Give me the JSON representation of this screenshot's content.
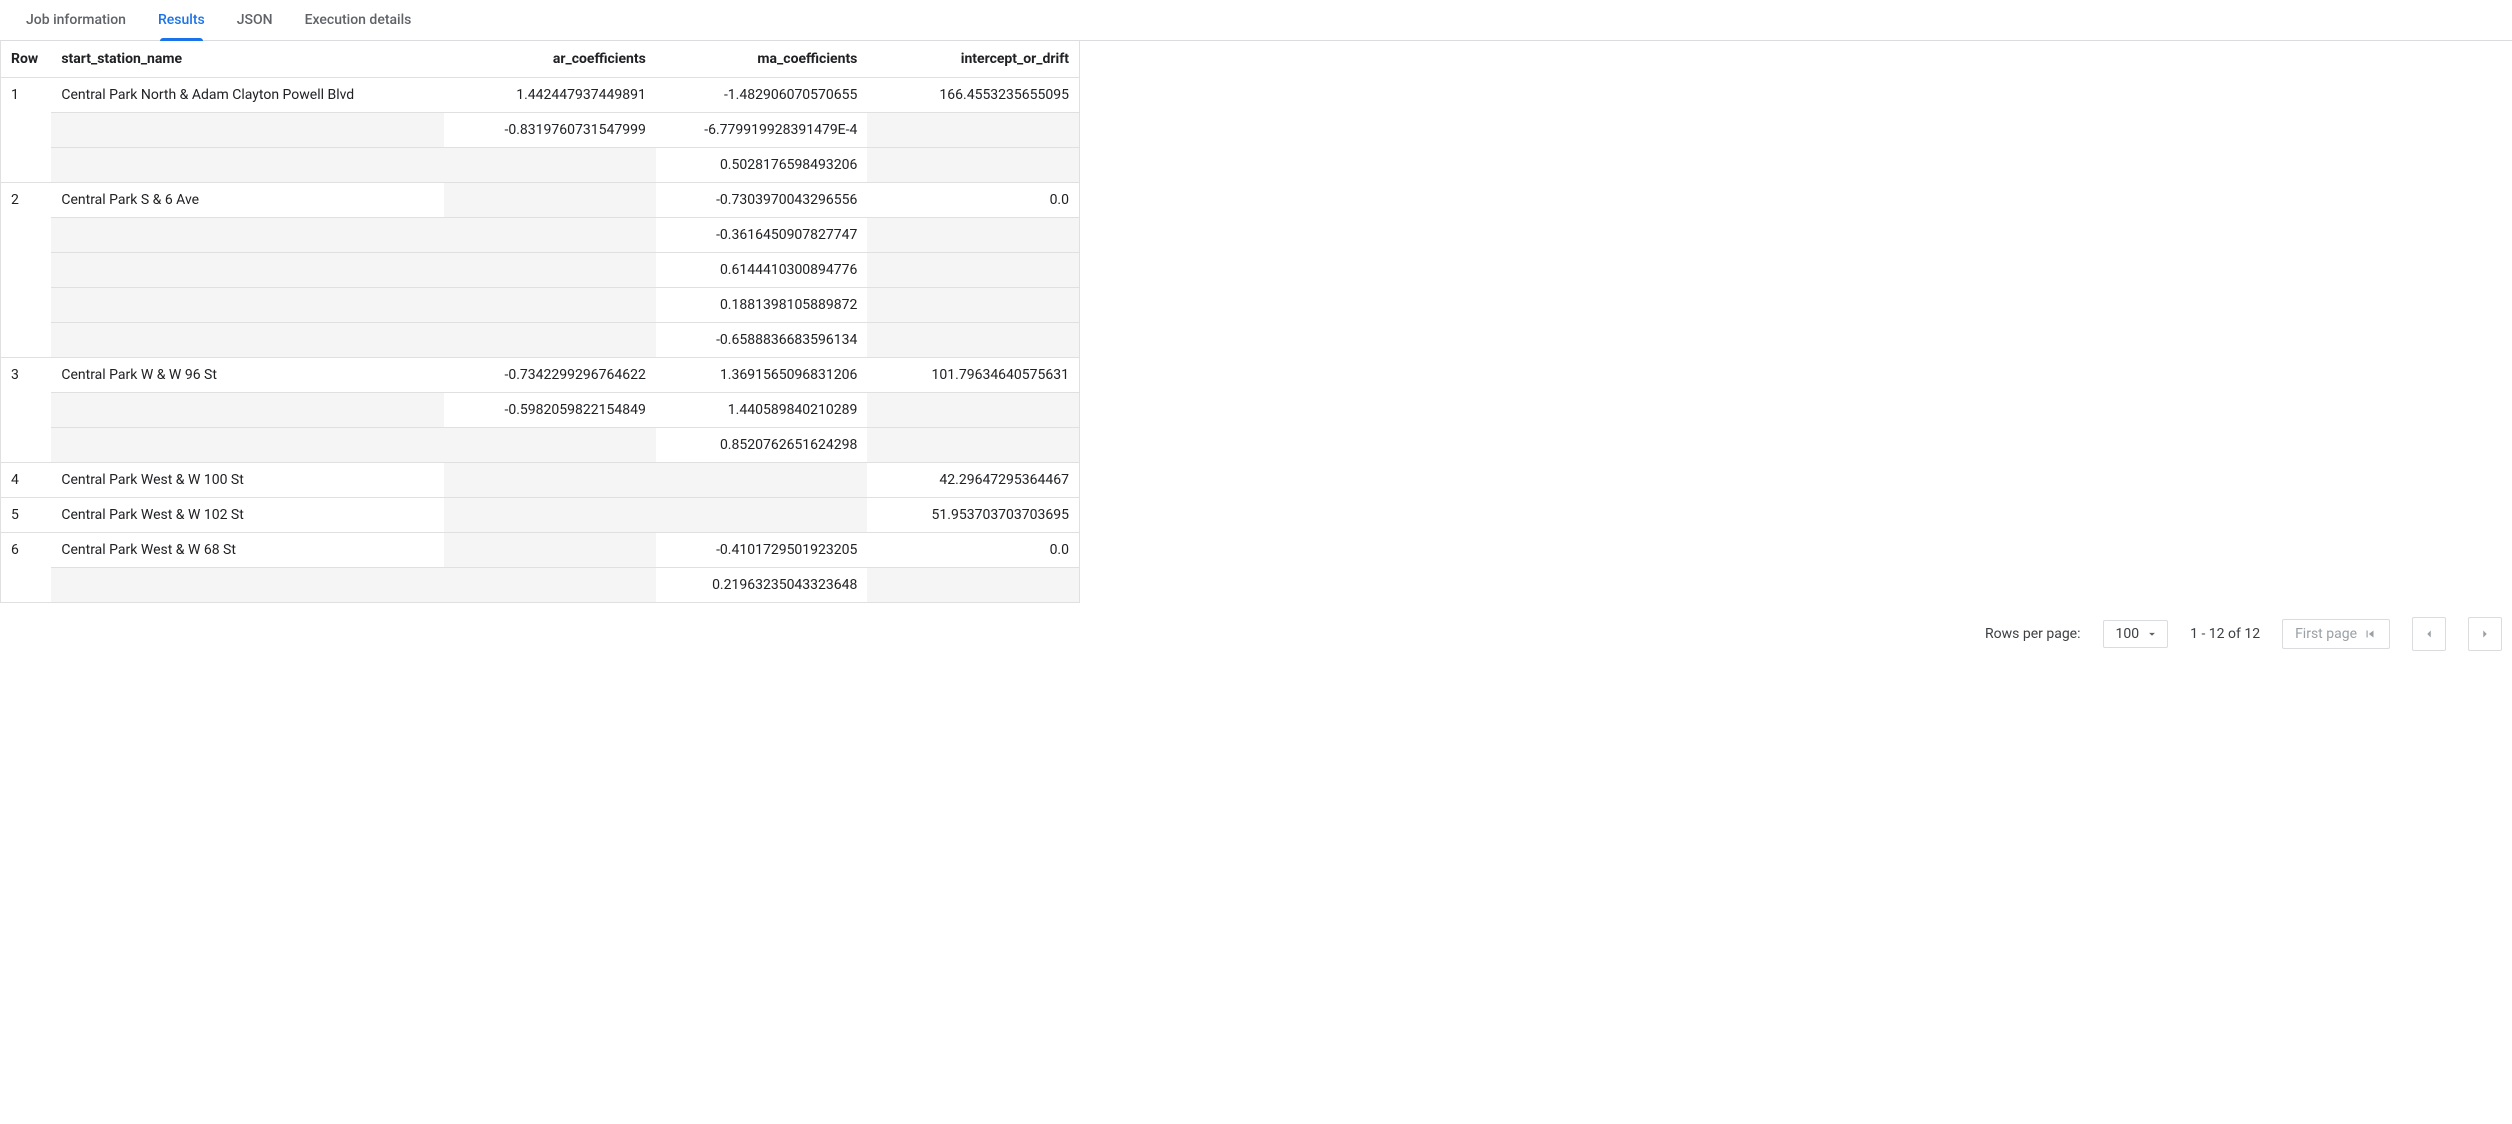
{
  "tabs": {
    "job_info": "Job information",
    "results": "Results",
    "json": "JSON",
    "exec_details": "Execution details"
  },
  "headers": {
    "row": "Row",
    "start_station_name": "start_station_name",
    "ar_coefficients": "ar_coefficients",
    "ma_coefficients": "ma_coefficients",
    "intercept": "intercept_or_drift"
  },
  "rows": [
    {
      "n": "1",
      "name": "Central Park North & Adam Clayton Powell Blvd",
      "lines": [
        {
          "ar": "1.442447937449891",
          "ma": "-1.482906070570655",
          "int": "166.4553235655095"
        },
        {
          "ar": "-0.8319760731547999",
          "ma": "-6.779919928391479E-4",
          "int": ""
        },
        {
          "ar": "",
          "ma": "0.5028176598493206",
          "int": ""
        }
      ]
    },
    {
      "n": "2",
      "name": "Central Park S & 6 Ave",
      "lines": [
        {
          "ar": "",
          "ma": "-0.7303970043296556",
          "int": "0.0"
        },
        {
          "ar": "",
          "ma": "-0.3616450907827747",
          "int": ""
        },
        {
          "ar": "",
          "ma": "0.6144410300894776",
          "int": ""
        },
        {
          "ar": "",
          "ma": "0.1881398105889872",
          "int": ""
        },
        {
          "ar": "",
          "ma": "-0.6588836683596134",
          "int": ""
        }
      ]
    },
    {
      "n": "3",
      "name": "Central Park W & W 96 St",
      "lines": [
        {
          "ar": "-0.7342299296764622",
          "ma": "1.3691565096831206",
          "int": "101.79634640575631"
        },
        {
          "ar": "-0.5982059822154849",
          "ma": "1.440589840210289",
          "int": ""
        },
        {
          "ar": "",
          "ma": "0.8520762651624298",
          "int": ""
        }
      ]
    },
    {
      "n": "4",
      "name": "Central Park West & W 100 St",
      "lines": [
        {
          "ar": "",
          "ma": "",
          "int": "42.29647295364467"
        }
      ]
    },
    {
      "n": "5",
      "name": "Central Park West & W 102 St",
      "lines": [
        {
          "ar": "",
          "ma": "",
          "int": "51.953703703703695"
        }
      ]
    },
    {
      "n": "6",
      "name": "Central Park West & W 68 St",
      "lines": [
        {
          "ar": "",
          "ma": "-0.4101729501923205",
          "int": "0.0"
        },
        {
          "ar": "",
          "ma": "0.21963235043323648",
          "int": ""
        }
      ]
    }
  ],
  "footer": {
    "rpp_label": "Rows per page:",
    "rpp_value": "100",
    "range": "1 - 12 of 12",
    "first_page": "First page"
  }
}
